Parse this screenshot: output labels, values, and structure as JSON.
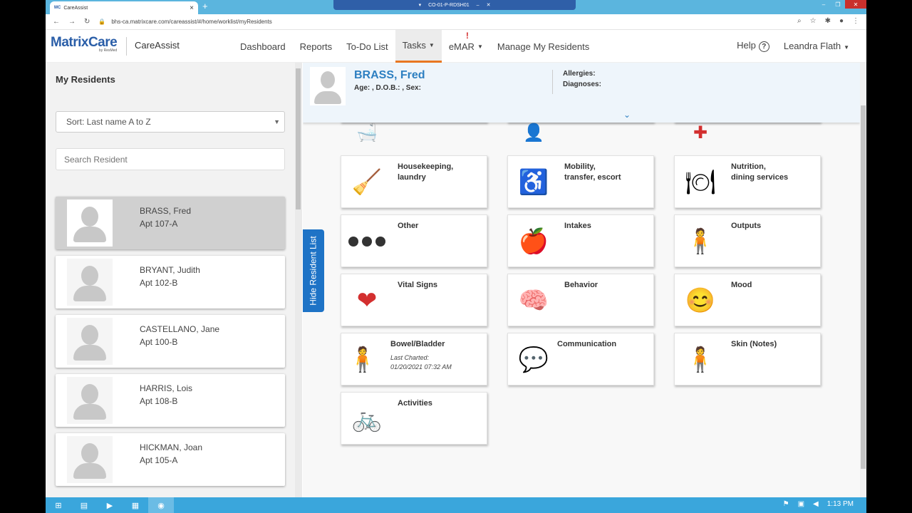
{
  "browser": {
    "tab_title": "CareAssist",
    "tab_favicon": "MC",
    "new_tab": "+",
    "url": "bhs-ca.matrixcare.com/careassist/#/home/worklist/myResidents",
    "remote_title": "CO-01-P-RDSH01"
  },
  "header": {
    "brand": "MatrixCare",
    "brand_sub": "by ResMed",
    "product": "CareAssist",
    "nav": {
      "dashboard": "Dashboard",
      "reports": "Reports",
      "todo": "To-Do List",
      "tasks": "Tasks",
      "emar": "eMAR",
      "manage": "Manage My Residents"
    },
    "alert_mark": "!",
    "help": "Help",
    "help_icon": "?",
    "user": "Leandra Flath"
  },
  "sidebar": {
    "title": "My Residents",
    "sort": "Sort: Last name A to Z",
    "search_placeholder": "Search Resident",
    "residents": [
      {
        "name": "BRASS, Fred",
        "apt": "Apt 107-A"
      },
      {
        "name": "BRYANT, Judith",
        "apt": "Apt 102-B"
      },
      {
        "name": "CASTELLANO, Jane",
        "apt": "Apt 100-B"
      },
      {
        "name": "HARRIS, Lois",
        "apt": "Apt 108-B"
      },
      {
        "name": "HICKMAN, Joan",
        "apt": "Apt 105-A"
      }
    ]
  },
  "patient": {
    "name": "BRASS, Fred",
    "info": "Age: , D.O.B.: , Sex:",
    "allergies": "Allergies:",
    "diagnoses": "Diagnoses:"
  },
  "hide_list": "Hide Resident List",
  "cards": {
    "housekeeping": "Housekeeping,\nlaundry",
    "mobility": "Mobility,\ntransfer, escort",
    "nutrition": "Nutrition,\ndining services",
    "other": "Other",
    "intakes": "Intakes",
    "outputs": "Outputs",
    "vitals": "Vital Signs",
    "behavior": "Behavior",
    "mood": "Mood",
    "bowel": "Bowel/Bladder",
    "bowel_sub": "Last Charted:\n01/20/2021 07:32 AM",
    "communication": "Communication",
    "skin": "Skin (Notes)",
    "activities": "Activities"
  },
  "taskbar": {
    "time": "1:13 PM"
  },
  "colors": {
    "brand_blue": "#2a5ea8",
    "accent_orange": "#e87722",
    "link_blue": "#2d7fc1"
  }
}
